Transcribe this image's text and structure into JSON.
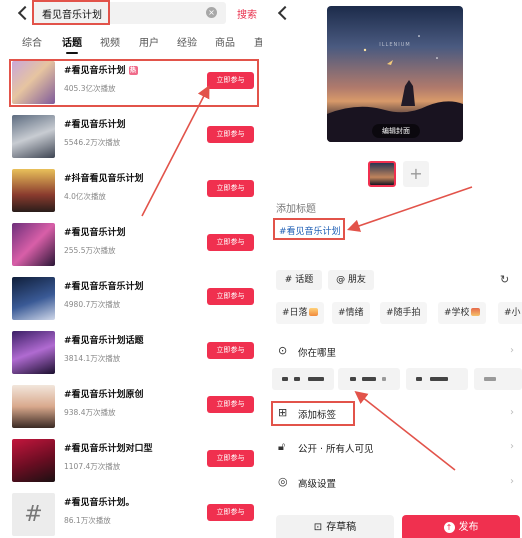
{
  "left": {
    "search": {
      "query": "看见音乐计划",
      "clear_icon": "×",
      "button": "搜索"
    },
    "tabs": [
      "综合",
      "话题",
      "视频",
      "用户",
      "经验",
      "商品",
      "直"
    ],
    "results": [
      {
        "title": "#看见音乐计划",
        "badge": "热",
        "plays": "405.3亿次播放",
        "action": "立即参与"
      },
      {
        "title": "#看见音乐计划",
        "plays": "5546.2万次播放",
        "action": "立即参与"
      },
      {
        "title": "#抖音看见音乐计划",
        "plays": "4.0亿次播放",
        "action": "立即参与"
      },
      {
        "title": "#看见音乐计划",
        "plays": "255.5万次播放",
        "action": "立即参与"
      },
      {
        "title": "#看见音乐音乐计划",
        "plays": "4980.7万次播放",
        "action": "立即参与"
      },
      {
        "title": "#看见音乐计划话题",
        "plays": "3814.1万次播放",
        "action": "立即参与"
      },
      {
        "title": "#看见音乐计划原创",
        "plays": "938.4万次播放",
        "action": "立即参与"
      },
      {
        "title": "#看见音乐计划对口型",
        "plays": "1107.4万次播放",
        "action": "立即参与"
      },
      {
        "title": "#看见音乐计划。",
        "plays": "86.1万次播放",
        "action": "立即参与",
        "thumb_symbol": "#"
      }
    ]
  },
  "right": {
    "cover": {
      "edit_label": "编辑封面",
      "title_text": "ILLENIUM"
    },
    "add_icon": "+",
    "add_title_label": "添加标题",
    "hashtag": "#看见音乐计划",
    "chips": {
      "topic": "# 话题",
      "friend": "@ 朋友"
    },
    "rotate_icon": "↻",
    "tags": [
      "#日落",
      "#情绪",
      "#随手拍",
      "#学校",
      "#小"
    ],
    "menu": {
      "location": "你在哪里",
      "add_tag": "添加标签",
      "visibility": "公开 · 所有人可见",
      "advanced": "高级设置"
    },
    "chevron": "›",
    "bottom": {
      "draft": "存草稿",
      "publish": "发布"
    }
  },
  "colors": {
    "accent": "#f0304f",
    "highlight": "#e2534a",
    "link": "#1f5fb5"
  }
}
